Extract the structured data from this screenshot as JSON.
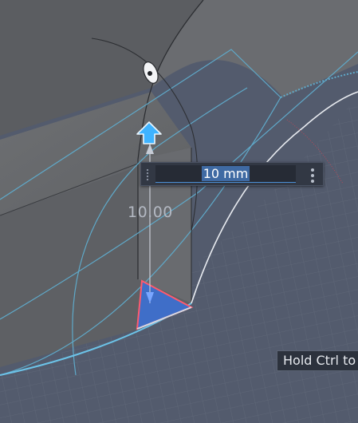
{
  "dimension_input": {
    "value": "10 mm"
  },
  "dimension_label": "10.00",
  "tooltip": "Hold Ctrl to",
  "icons": {
    "extrude_arrow": "up-arrow-icon",
    "pivot": "pivot-eye-icon",
    "menu": "vertical-dots-icon",
    "grip": "drag-grip-icon"
  },
  "colors": {
    "background": "#525a6c",
    "body_face": "#6d6f72",
    "body_face_dark": "#5e6063",
    "selection_blue": "#3f6ec8",
    "selection_edge": "#ff5a6e",
    "guide_cyan": "#5fa9c9",
    "arrow_cyan": "#3fb3ff"
  }
}
